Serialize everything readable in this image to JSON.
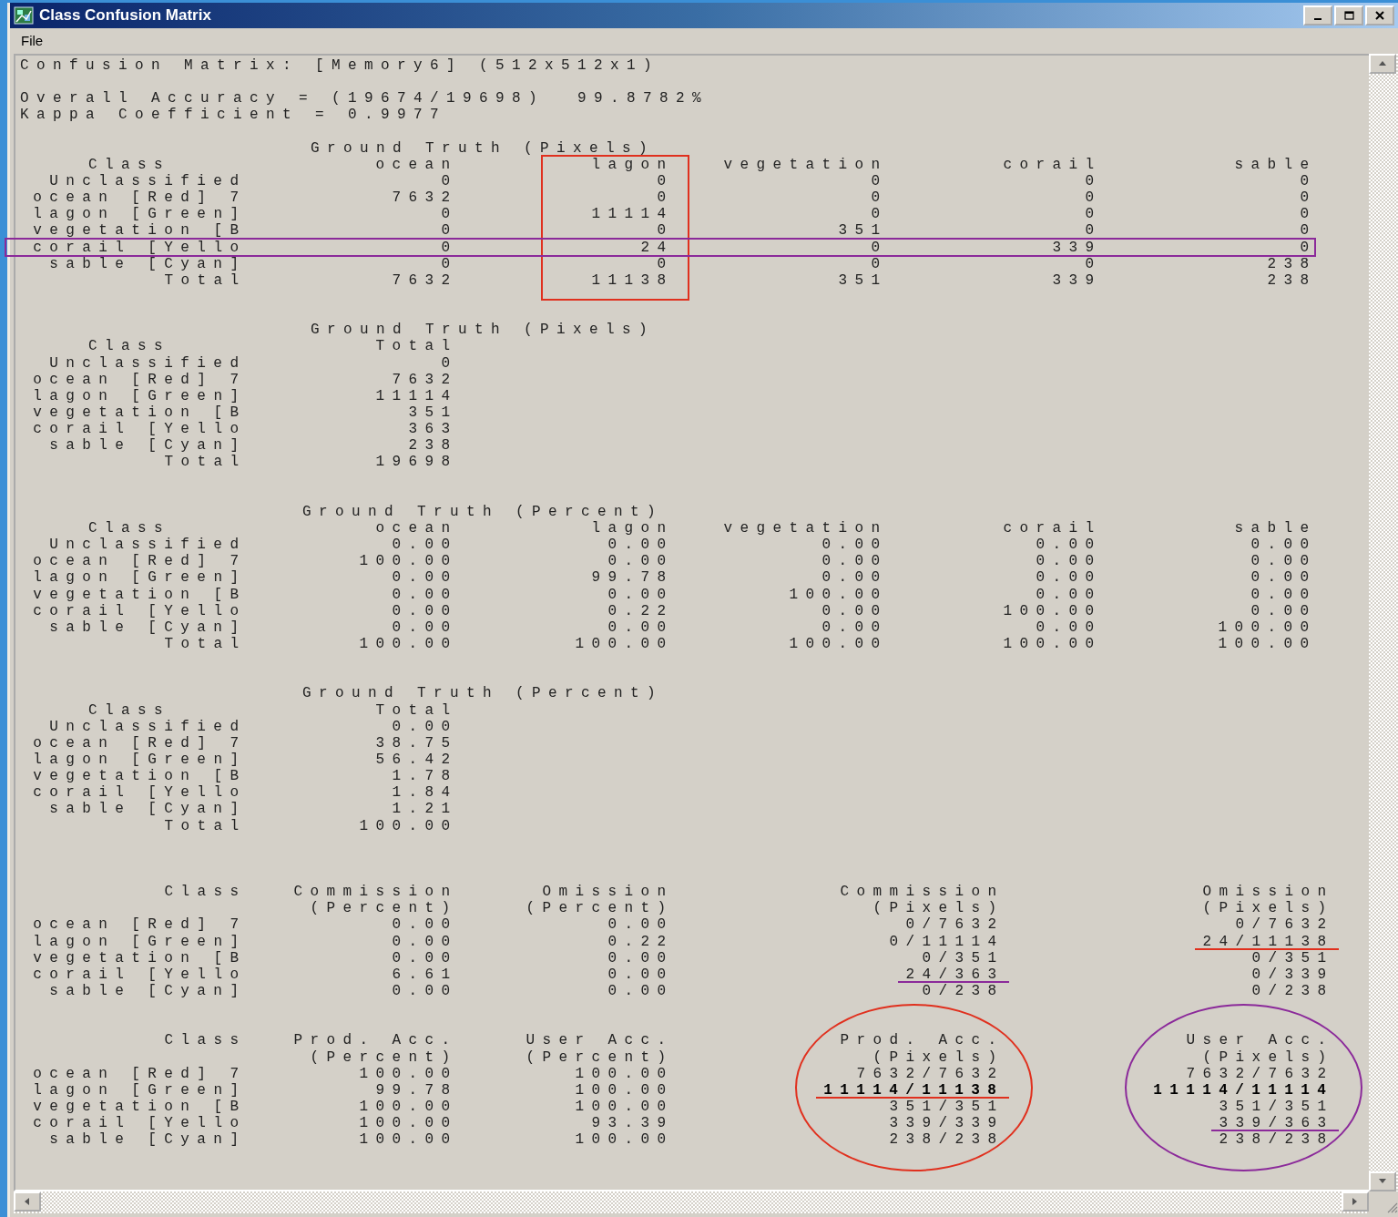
{
  "window": {
    "title": "Class Confusion Matrix"
  },
  "menu": [
    "File"
  ],
  "report": {
    "title_line": "Confusion Matrix: [Memory6] (512x512x1)",
    "summary": [
      "Overall Accuracy = (19674/19698)  99.8782%",
      "Kappa Coefficient = 0.9977"
    ]
  },
  "tables": [
    {
      "kind": "matrix",
      "title": "Ground Truth (Pixels)",
      "class_header": "Class",
      "columns": [
        {
          "header": [
            "ocean"
          ]
        },
        {
          "header": [
            "lagon"
          ],
          "annotation": {
            "kind": "box",
            "color": "#e0301e"
          }
        },
        {
          "header": [
            "vegetation"
          ]
        },
        {
          "header": [
            "corail"
          ]
        },
        {
          "header": [
            "sable"
          ]
        }
      ],
      "rows": [
        {
          "label": "Unclassified",
          "cells": [
            "0",
            "0",
            "0",
            "0",
            "0"
          ]
        },
        {
          "label": "ocean [Red] 7",
          "cells": [
            "7632",
            "0",
            "0",
            "0",
            "0"
          ]
        },
        {
          "label": "lagon [Green]",
          "cells": [
            "0",
            "11114",
            "0",
            "0",
            "0"
          ]
        },
        {
          "label": "vegetation [B",
          "cells": [
            "0",
            "0",
            "351",
            "0",
            "0"
          ]
        },
        {
          "label": "corail [Yello",
          "cells": [
            "0",
            "24",
            "0",
            "339",
            "0"
          ],
          "annotation": {
            "kind": "box",
            "color": "#8b2a9a"
          }
        },
        {
          "label": "sable [Cyan]",
          "cells": [
            "0",
            "0",
            "0",
            "0",
            "238"
          ]
        },
        {
          "label": "Total",
          "cells": [
            "7632",
            "11138",
            "351",
            "339",
            "238"
          ]
        }
      ]
    },
    {
      "kind": "matrix",
      "title": "Ground Truth (Pixels)",
      "class_header": "Class",
      "columns": [
        {
          "header": [
            "Total"
          ]
        }
      ],
      "rows": [
        {
          "label": "Unclassified",
          "cells": [
            "0"
          ]
        },
        {
          "label": "ocean [Red] 7",
          "cells": [
            "7632"
          ]
        },
        {
          "label": "lagon [Green]",
          "cells": [
            "11114"
          ]
        },
        {
          "label": "vegetation [B",
          "cells": [
            "351"
          ]
        },
        {
          "label": "corail [Yello",
          "cells": [
            "363"
          ]
        },
        {
          "label": "sable [Cyan]",
          "cells": [
            "238"
          ]
        },
        {
          "label": "Total",
          "cells": [
            "19698"
          ]
        }
      ]
    },
    {
      "kind": "matrix",
      "title": "Ground Truth (Percent)",
      "class_header": "Class",
      "columns": [
        {
          "header": [
            "ocean"
          ]
        },
        {
          "header": [
            "lagon"
          ]
        },
        {
          "header": [
            "vegetation"
          ]
        },
        {
          "header": [
            "corail"
          ]
        },
        {
          "header": [
            "sable"
          ]
        }
      ],
      "rows": [
        {
          "label": "Unclassified",
          "cells": [
            "0.00",
            "0.00",
            "0.00",
            "0.00",
            "0.00"
          ]
        },
        {
          "label": "ocean [Red] 7",
          "cells": [
            "100.00",
            "0.00",
            "0.00",
            "0.00",
            "0.00"
          ]
        },
        {
          "label": "lagon [Green]",
          "cells": [
            "0.00",
            "99.78",
            "0.00",
            "0.00",
            "0.00"
          ]
        },
        {
          "label": "vegetation [B",
          "cells": [
            "0.00",
            "0.00",
            "100.00",
            "0.00",
            "0.00"
          ]
        },
        {
          "label": "corail [Yello",
          "cells": [
            "0.00",
            "0.22",
            "0.00",
            "100.00",
            "0.00"
          ]
        },
        {
          "label": "sable [Cyan]",
          "cells": [
            "0.00",
            "0.00",
            "0.00",
            "0.00",
            "100.00"
          ]
        },
        {
          "label": "Total",
          "cells": [
            "100.00",
            "100.00",
            "100.00",
            "100.00",
            "100.00"
          ]
        }
      ]
    },
    {
      "kind": "matrix",
      "title": "Ground Truth (Percent)",
      "class_header": "Class",
      "columns": [
        {
          "header": [
            "Total"
          ]
        }
      ],
      "rows": [
        {
          "label": "Unclassified",
          "cells": [
            "0.00"
          ]
        },
        {
          "label": "ocean [Red] 7",
          "cells": [
            "38.75"
          ]
        },
        {
          "label": "lagon [Green]",
          "cells": [
            "56.42"
          ]
        },
        {
          "label": "vegetation [B",
          "cells": [
            "1.78"
          ]
        },
        {
          "label": "corail [Yello",
          "cells": [
            "1.84"
          ]
        },
        {
          "label": "sable [Cyan]",
          "cells": [
            "1.21"
          ]
        },
        {
          "label": "Total",
          "cells": [
            "100.00"
          ]
        }
      ]
    },
    {
      "kind": "accuracy",
      "class_header": "Class",
      "columns": [
        {
          "header": [
            "Commission",
            "(Percent)"
          ]
        },
        {
          "header": [
            "Omission",
            "(Percent)"
          ]
        },
        {
          "header": [
            "Commission",
            "(Pixels)"
          ]
        },
        {
          "header": [
            "Omission",
            "(Pixels)"
          ]
        }
      ],
      "rows": [
        {
          "label": "ocean [Red] 7",
          "cells": [
            "0.00",
            "0.00",
            "0/7632",
            "0/7632"
          ]
        },
        {
          "label": "lagon [Green]",
          "cells": [
            "0.00",
            "0.22",
            "0/11114",
            {
              "text": "24/11138",
              "annotation": {
                "kind": "underline",
                "color": "#e0301e"
              }
            }
          ]
        },
        {
          "label": "vegetation [B",
          "cells": [
            "0.00",
            "0.00",
            "0/351",
            "0/351"
          ]
        },
        {
          "label": "corail [Yello",
          "cells": [
            "6.61",
            "0.00",
            {
              "text": "24/363",
              "annotation": {
                "kind": "underline",
                "color": "#8b2a9a"
              }
            },
            "0/339"
          ]
        },
        {
          "label": "sable [Cyan]",
          "cells": [
            "0.00",
            "0.00",
            "0/238",
            "0/238"
          ]
        }
      ]
    },
    {
      "kind": "accuracy",
      "class_header": "Class",
      "columns": [
        {
          "header": [
            "Prod. Acc.",
            "(Percent)"
          ]
        },
        {
          "header": [
            "User Acc.",
            "(Percent)"
          ]
        },
        {
          "header": [
            "Prod. Acc.",
            "(Pixels)"
          ],
          "annotation": {
            "kind": "ellipse",
            "color": "#e0301e"
          }
        },
        {
          "header": [
            "User Acc.",
            "(Pixels)"
          ],
          "annotation": {
            "kind": "ellipse",
            "color": "#8b2a9a"
          }
        }
      ],
      "rows": [
        {
          "label": "ocean [Red] 7",
          "cells": [
            "100.00",
            "100.00",
            "7632/7632",
            "7632/7632"
          ]
        },
        {
          "label": "lagon [Green]",
          "cells": [
            "99.78",
            "100.00",
            {
              "text": "11114/11138",
              "bold": true,
              "annotation": {
                "kind": "underline",
                "color": "#e0301e"
              }
            },
            {
              "text": "11114/11114",
              "bold": true
            }
          ]
        },
        {
          "label": "vegetation [B",
          "cells": [
            "100.00",
            "100.00",
            "351/351",
            "351/351"
          ]
        },
        {
          "label": "corail [Yello",
          "cells": [
            "100.00",
            "93.39",
            "339/339",
            {
              "text": "339/363",
              "annotation": {
                "kind": "underline",
                "color": "#8b2a9a"
              }
            }
          ]
        },
        {
          "label": "sable [Cyan]",
          "cells": [
            "100.00",
            "100.00",
            "238/238",
            "238/238"
          ]
        }
      ]
    }
  ]
}
